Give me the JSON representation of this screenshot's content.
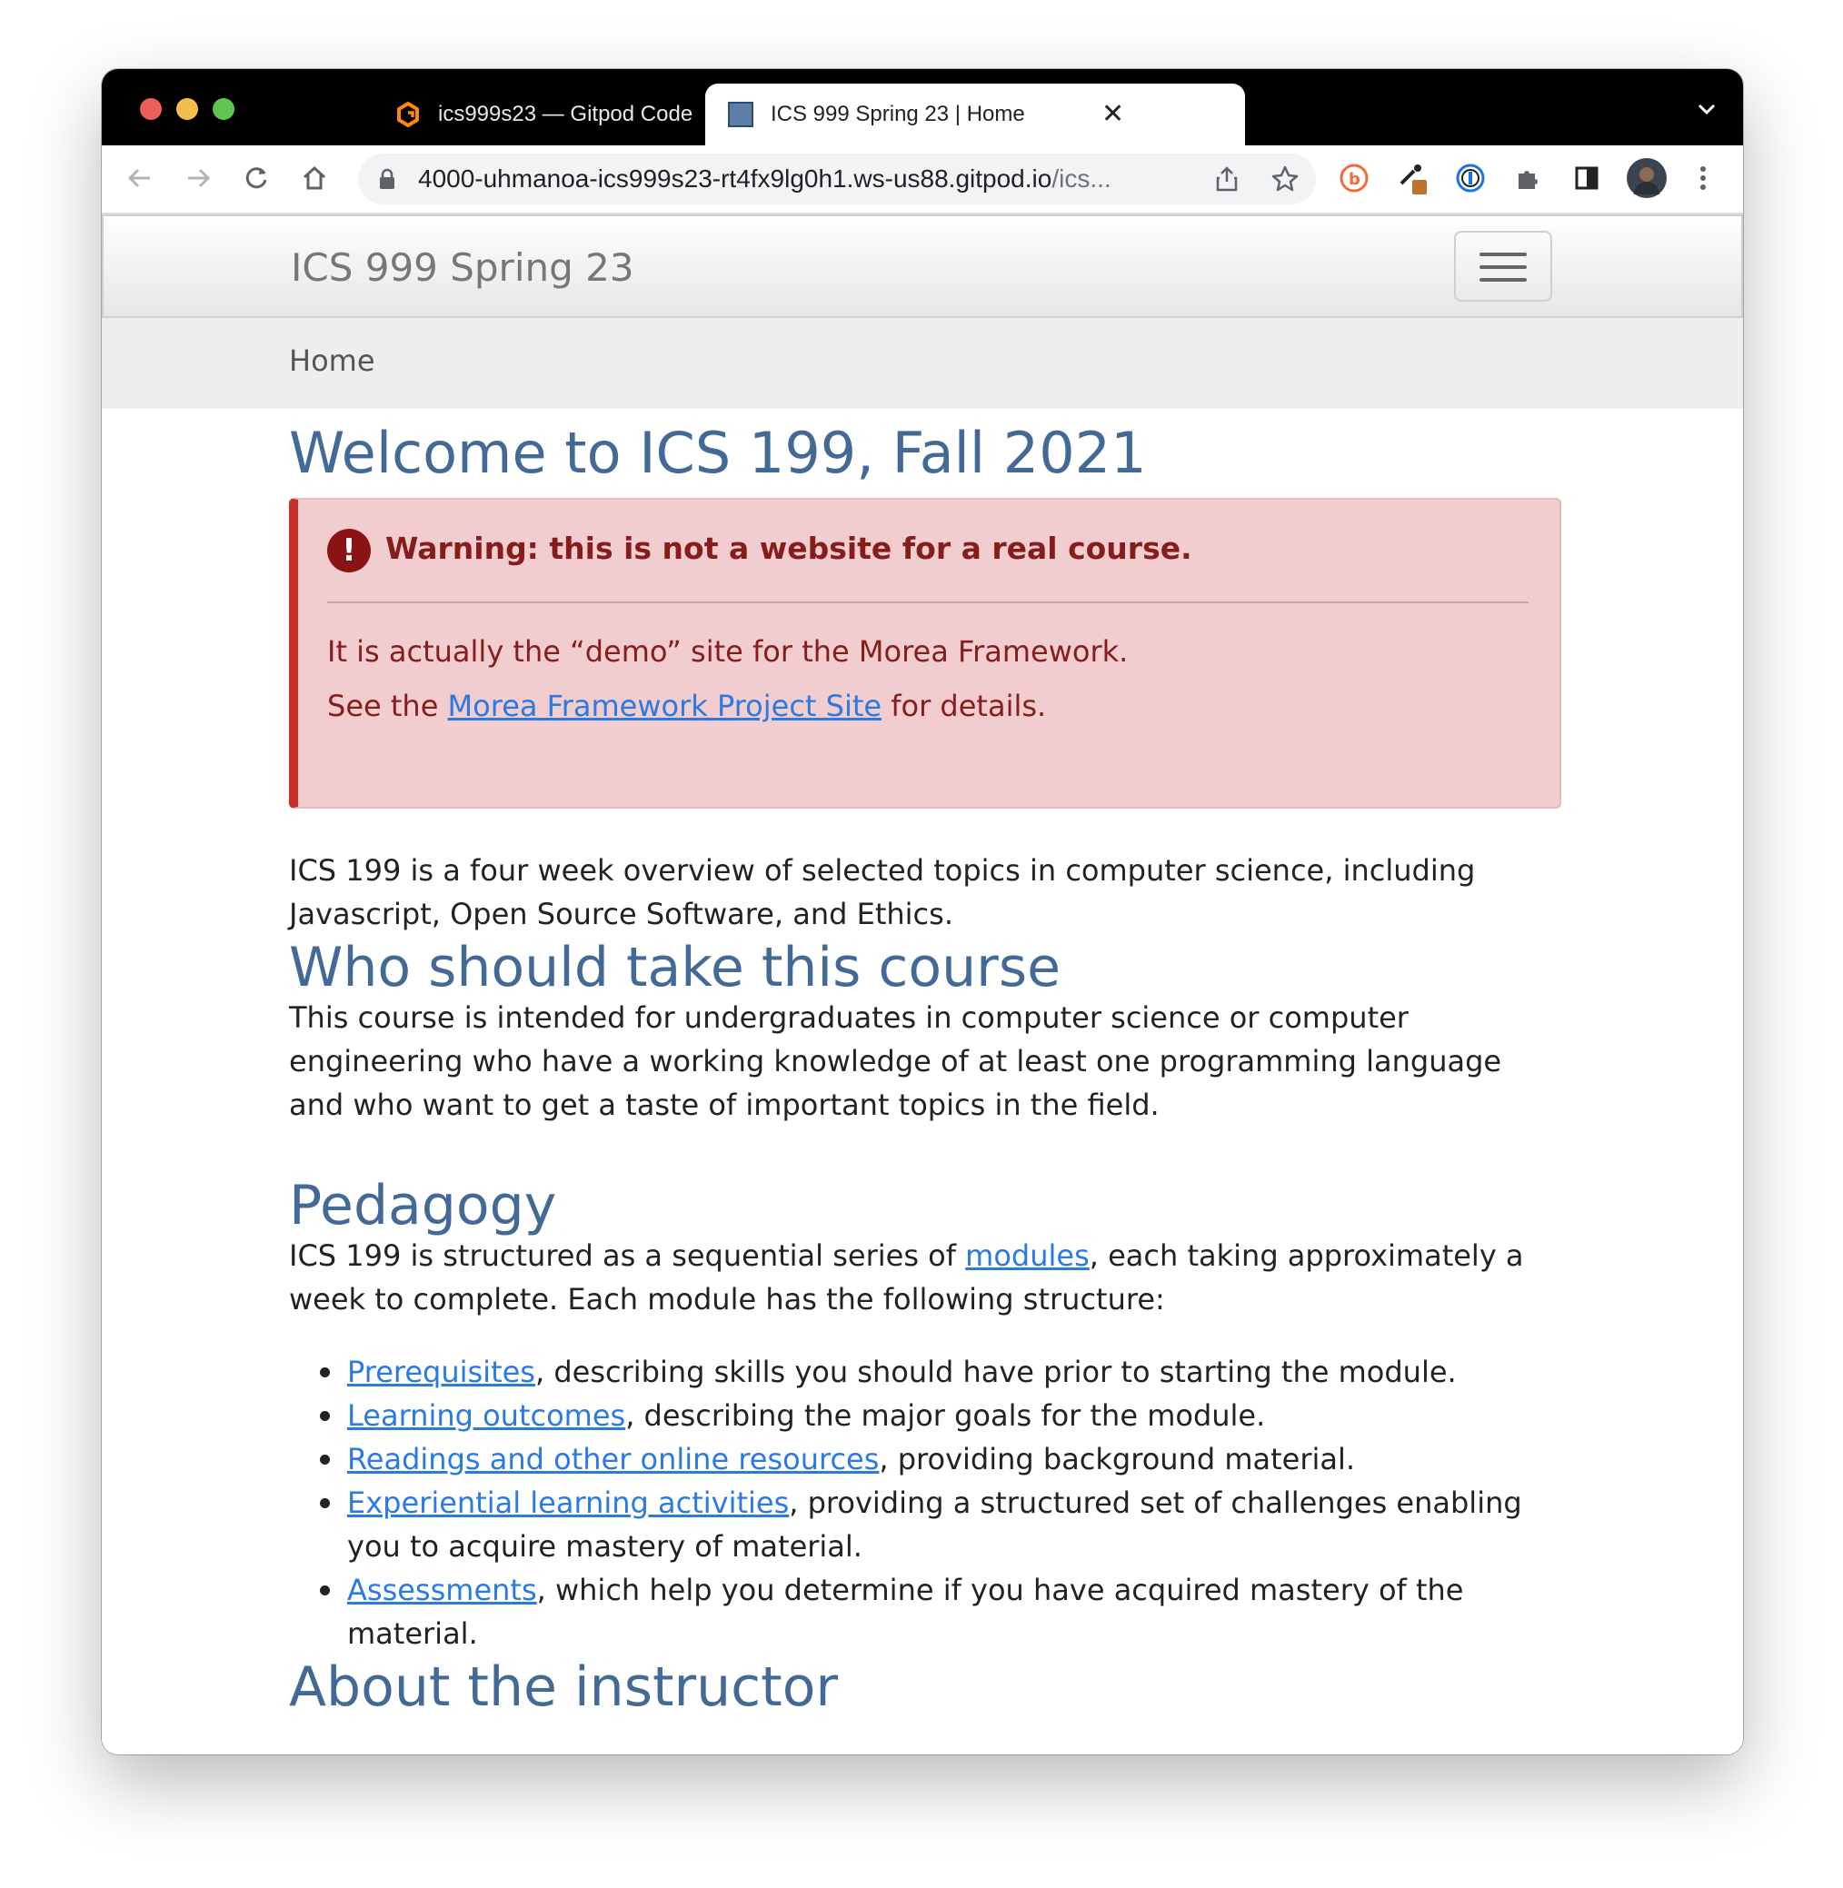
{
  "browser": {
    "tabs": [
      {
        "title": "ics999s23 — Gitpod Code",
        "active": false
      },
      {
        "title": "ICS 999 Spring 23 | Home",
        "active": true
      }
    ],
    "url_main": "4000-uhmanoa-ics999s23-rt4fx9lg0h1.ws-us88.gitpod.io",
    "url_dim": "/ics..."
  },
  "site": {
    "brand": "ICS 999 Spring 23",
    "breadcrumb": "Home"
  },
  "page": {
    "title": "Welcome to ICS 199, Fall 2021",
    "alert": {
      "title": "Warning: this is not a website for a real course.",
      "line1": "It is actually the “demo” site for the Morea Framework.",
      "line2_prefix": "See the ",
      "line2_link": "Morea Framework Project Site",
      "line2_suffix": " for details."
    },
    "intro": "ICS 199 is a four week overview of selected topics in computer science, including Javascript, Open Source Software, and Ethics.",
    "who_heading": "Who should take this course",
    "who_text": "This course is intended for undergraduates in computer science or computer engineering who have a working knowledge of at least one programming language and who want to get a taste of important topics in the field.",
    "pedagogy_heading": "Pedagogy",
    "pedagogy_prefix": "ICS 199 is structured as a sequential series of ",
    "pedagogy_link": "modules",
    "pedagogy_suffix": ", each taking approximately a week to complete. Each module has the following structure:",
    "module_items": [
      {
        "link": "Prerequisites",
        "text": ", describing skills you should have prior to starting the module."
      },
      {
        "link": "Learning outcomes",
        "text": ", describing the major goals for the module."
      },
      {
        "link": "Readings and other online resources",
        "text": ", providing background material."
      },
      {
        "link": "Experiential learning activities",
        "text": ", providing a structured set of challenges enabling you to acquire mastery of material."
      },
      {
        "link": "Assessments",
        "text": ", which help you determine if you have acquired mastery of the material."
      }
    ],
    "instructor_heading": "About the instructor"
  },
  "colors": {
    "heading": "#436a96",
    "link": "#2a7ae2",
    "alert_bg": "#f1cdcf",
    "alert_border": "#c5302a",
    "alert_text": "#861c1c"
  }
}
